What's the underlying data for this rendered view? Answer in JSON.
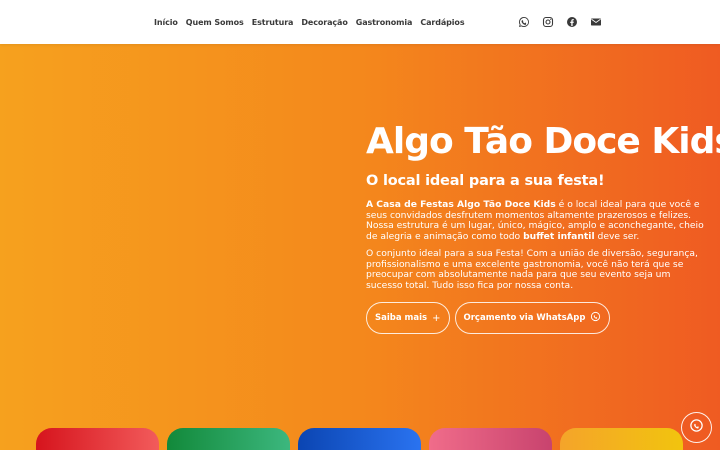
{
  "nav": {
    "links": [
      "Início",
      "Quem Somos",
      "Estrutura",
      "Decoração",
      "Gastronomia",
      "Cardápios"
    ],
    "icons": [
      "whatsapp-icon",
      "instagram-icon",
      "facebook-icon",
      "email-icon"
    ]
  },
  "hero": {
    "title": "Algo Tão Doce Kids",
    "subtitle": "O local ideal para a sua festa!",
    "para1_bold": "A Casa de Festas Algo Tão Doce Kids",
    "para1_text": " é o local ideal para que você e seus convidados desfrutem momentos altamente prazerosos e felizes. Nossa estrutura é um lugar, único, mágico, amplo e aconchegante, cheio de alegria e animação como todo ",
    "para1_bold2": "buffet infantil",
    "para1_end": " deve ser.",
    "para2": "O conjunto ideal para a sua Festa! Com a união de diversão, segurança, profissionalismo e uma excelente gastronomia, você não terá que se preocupar com absolutamente nada para que seu evento seja um sucesso total. Tudo isso fica por nossa conta.",
    "btn_more": "Saiba mais",
    "btn_more_icon": "+",
    "btn_quote": "Orçamento via WhatsApp"
  },
  "colors": {
    "hero_start": "#f6a11e",
    "hero_end": "#ef5b22",
    "card_colors": [
      "#d6141d",
      "#12893a",
      "#0b45b2",
      "#f06c8a",
      "#f4a42a"
    ]
  }
}
